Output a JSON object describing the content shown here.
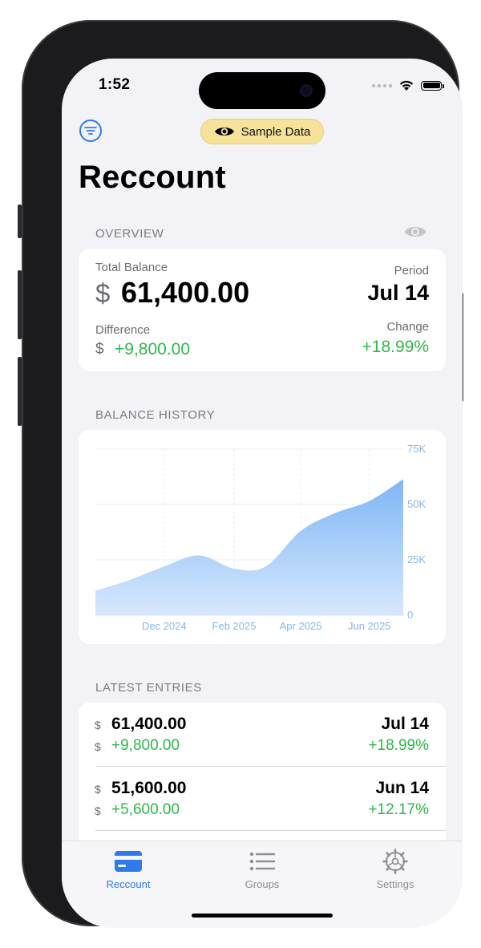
{
  "status": {
    "time": "1:52"
  },
  "header": {
    "sample_label": "Sample Data",
    "title": "Reccount"
  },
  "overview": {
    "section": "OVERVIEW",
    "total_label": "Total Balance",
    "currency": "$",
    "total_value": "61,400.00",
    "period_label": "Period",
    "period_value": "Jul 14",
    "difference_label": "Difference",
    "difference_value": "+9,800.00",
    "change_label": "Change",
    "change_value": "+18.99%"
  },
  "history": {
    "section": "BALANCE HISTORY"
  },
  "chart_data": {
    "type": "area",
    "x": [
      "2024-10-14",
      "2024-11-14",
      "2024-12-14",
      "2025-01-14",
      "2025-02-14",
      "2025-03-14",
      "2025-04-14",
      "2025-05-14",
      "2025-06-14",
      "2025-07-14"
    ],
    "values": [
      11000,
      16000,
      22000,
      27000,
      21000,
      22000,
      38000,
      46000,
      51600,
      61400
    ],
    "x_tick_labels": [
      "Dec 2024",
      "Feb 2025",
      "Apr 2025",
      "Jun 2025"
    ],
    "y_tick_labels": [
      "75K",
      "50K",
      "25K",
      "0"
    ],
    "ylim": [
      0,
      75000
    ],
    "grid": true,
    "color": "#7fb6f6"
  },
  "entries": {
    "section": "LATEST ENTRIES",
    "currency": "$",
    "items": [
      {
        "amount": "61,400.00",
        "difference": "+9,800.00",
        "date": "Jul 14",
        "change": "+18.99%"
      },
      {
        "amount": "51,600.00",
        "difference": "+5,600.00",
        "date": "Jun 14",
        "change": "+12.17%"
      }
    ]
  },
  "tabs": [
    {
      "label": "Reccount",
      "icon": "credit-card-icon",
      "active": true
    },
    {
      "label": "Groups",
      "icon": "list-icon",
      "active": false
    },
    {
      "label": "Settings",
      "icon": "gear-icon",
      "active": false
    }
  ],
  "colors": {
    "accent": "#2f7bea",
    "positive": "#2db84b",
    "sample_pill": "#f7e29a"
  }
}
